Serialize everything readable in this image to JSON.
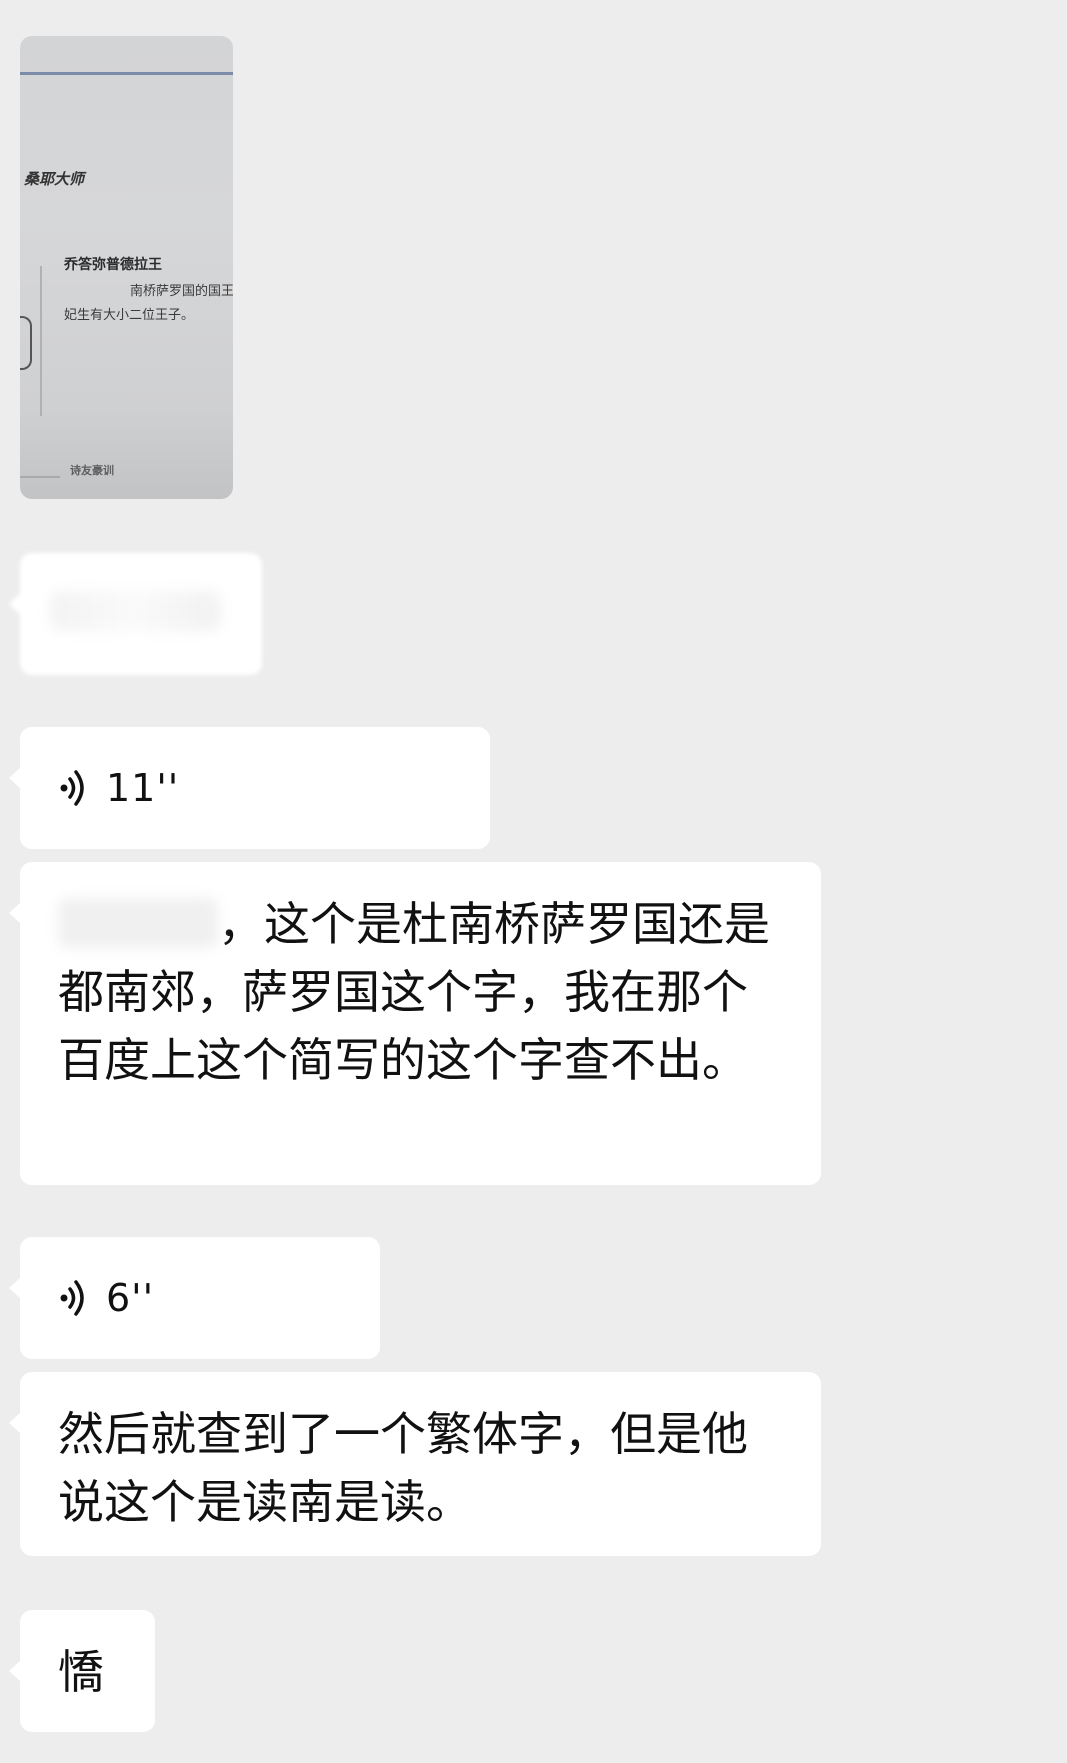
{
  "photo": {
    "line1": "桑耶大师",
    "line2": "乔答弥普德拉王",
    "line3": "南桥萨罗国的国王",
    "line4": "妃生有大小二位王子。",
    "line5": "诗友豪训"
  },
  "voice_messages": [
    {
      "duration": "11''"
    },
    {
      "duration": "6''"
    }
  ],
  "text_messages": [
    {
      "text": "，这个是杜南桥萨罗国还是都南郊，萨罗国这个字，我在那个百度上这个简写的这个字查不出。"
    },
    {
      "text": "然后就查到了一个繁体字，但是他说这个是读南是读。"
    },
    {
      "text": "憍"
    }
  ],
  "colors": {
    "background": "#ededed",
    "bubble": "#ffffff",
    "text": "#111111"
  },
  "icons": {
    "voice": "voice-wave-icon"
  }
}
